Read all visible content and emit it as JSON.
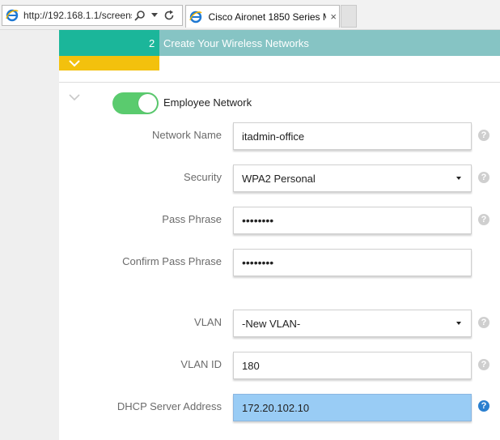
{
  "browser": {
    "address_url": "http://192.168.1.1/screens/",
    "tab_title": "Cisco Aironet 1850 Series M...",
    "tab_close": "×"
  },
  "wizard": {
    "step_number": "2",
    "step_title": "Create Your Wireless Networks"
  },
  "network": {
    "title": "Employee Network",
    "enabled": true,
    "fields": {
      "network_name": {
        "label": "Network Name",
        "value": "itadmin-office"
      },
      "security": {
        "label": "Security",
        "value": "WPA2 Personal"
      },
      "pass_phrase": {
        "label": "Pass Phrase",
        "value": "••••••••"
      },
      "confirm_pass_phrase": {
        "label": "Confirm Pass Phrase",
        "value": "••••••••"
      },
      "vlan": {
        "label": "VLAN",
        "value": "-New VLAN-"
      },
      "vlan_id": {
        "label": "VLAN ID",
        "value": "180"
      },
      "dhcp_server_address": {
        "label": "DHCP Server Address",
        "value": "172.20.102.10"
      }
    },
    "help_glyph": "?"
  },
  "colors": {
    "step_active": "#1bb69a",
    "step_bar": "#86c4c4",
    "collapse_bar": "#f3c10d",
    "toggle_on": "#5acb6e",
    "active_field": "#99ccf5",
    "help_active": "#2a7fcf"
  }
}
